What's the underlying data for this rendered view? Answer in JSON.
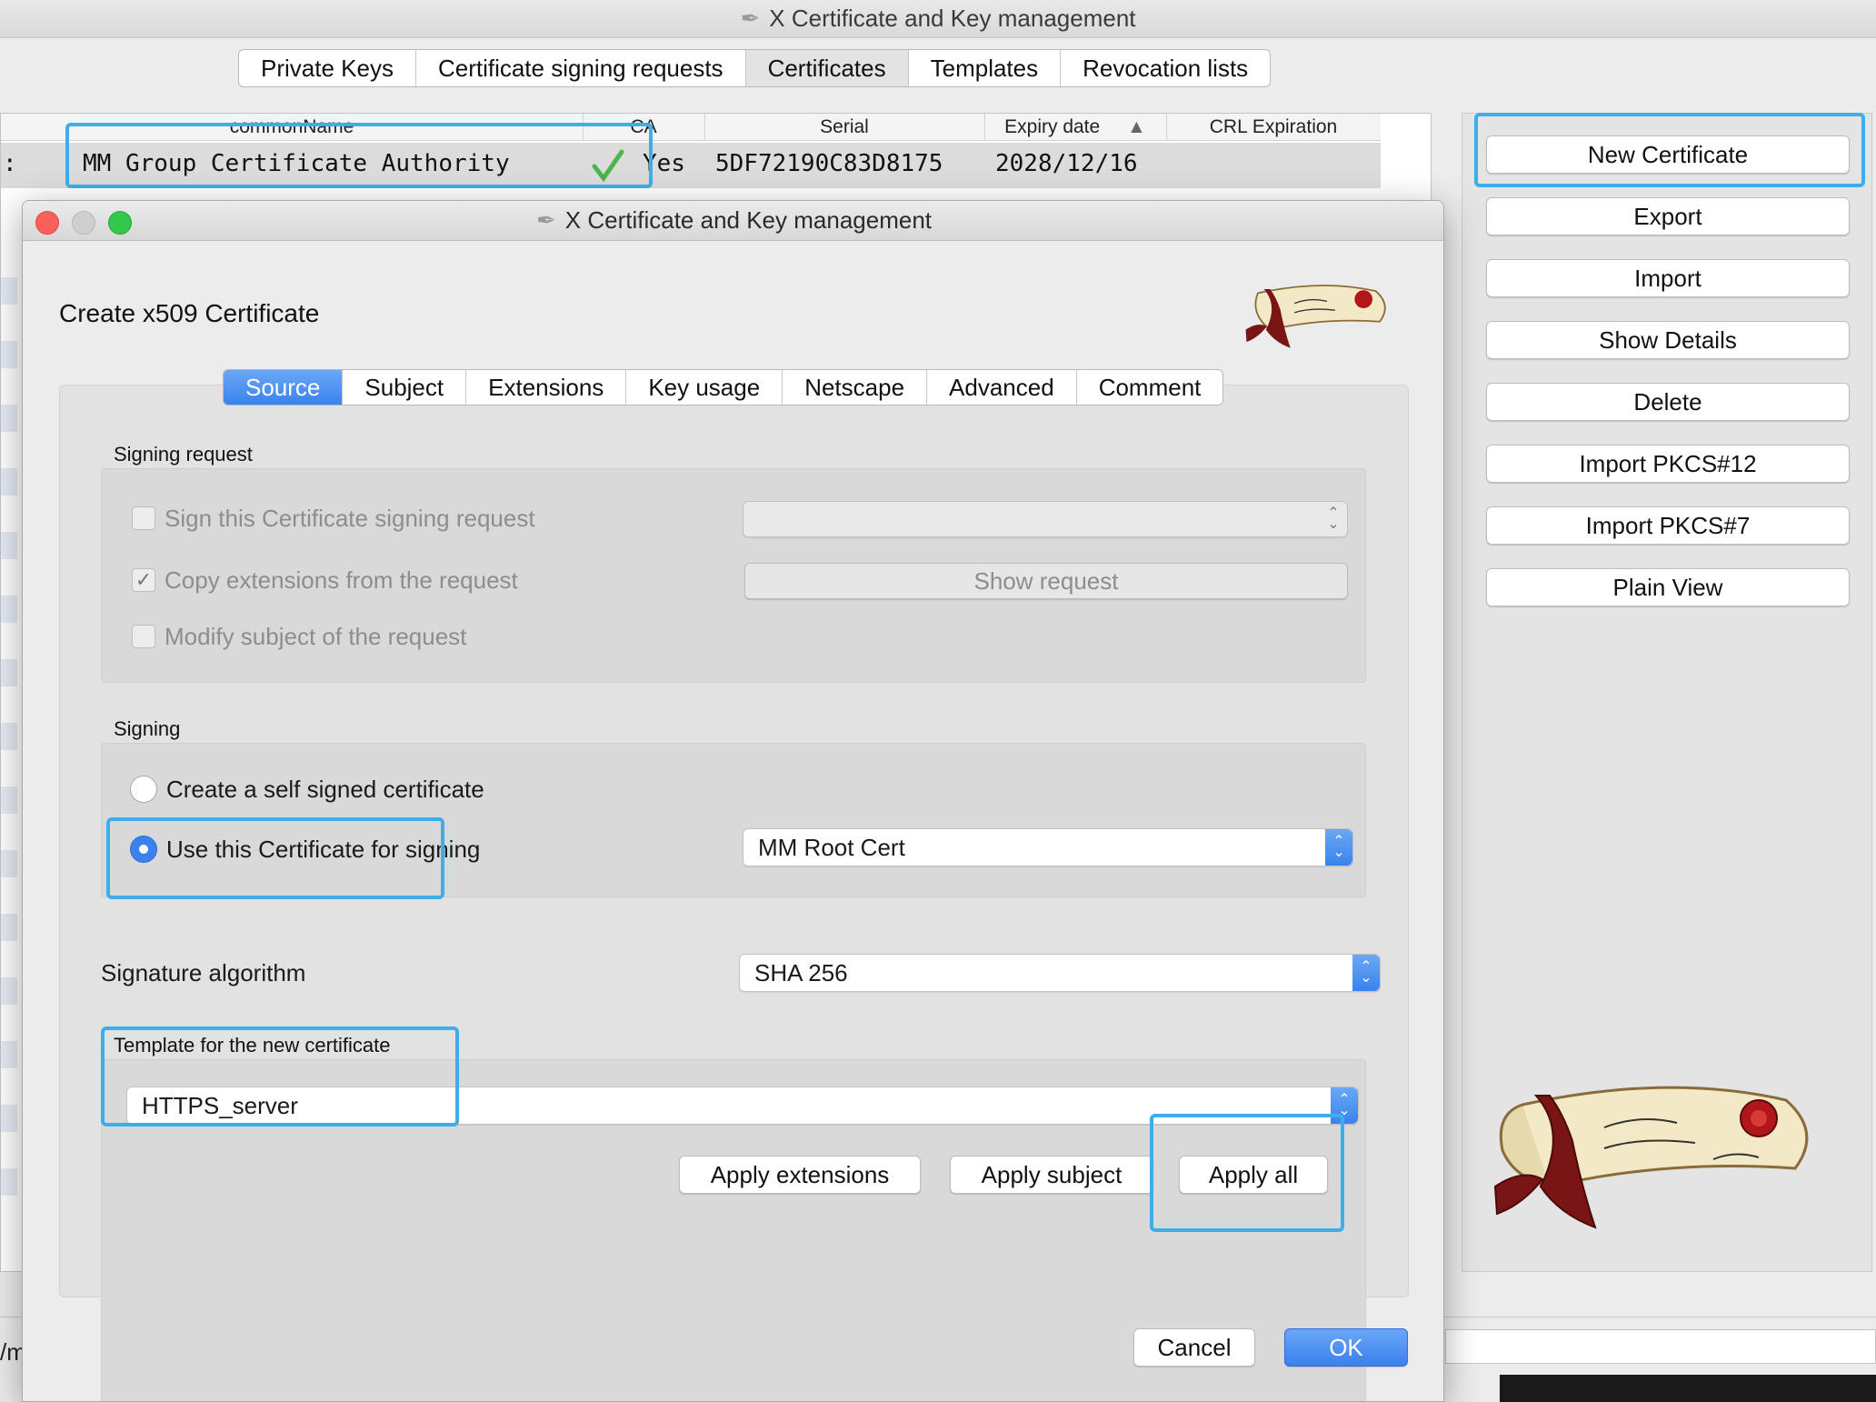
{
  "main": {
    "title": "X Certificate and Key management",
    "tabs": [
      {
        "label": "Private Keys"
      },
      {
        "label": "Certificate signing requests"
      },
      {
        "label": "Certificates"
      },
      {
        "label": "Templates"
      },
      {
        "label": "Revocation lists"
      }
    ],
    "table": {
      "columns": [
        "commonName",
        "CA",
        "Serial",
        "Expiry date",
        "CRL Expiration"
      ],
      "sort_indicator": "▲",
      "row": {
        "commonName": "MM Group Certificate Authority",
        "ca": "Yes",
        "serial": "5DF72190C83D8175",
        "expiry": "2028/12/16",
        "crl": ""
      }
    },
    "side_buttons": [
      {
        "label": "New Certificate"
      },
      {
        "label": "Export"
      },
      {
        "label": "Import"
      },
      {
        "label": "Show Details"
      },
      {
        "label": "Delete"
      },
      {
        "label": "Import PKCS#12"
      },
      {
        "label": "Import PKCS#7"
      },
      {
        "label": "Plain View"
      }
    ],
    "status_text": "/m"
  },
  "dialog": {
    "title": "X Certificate and Key management",
    "heading": "Create x509 Certificate",
    "tabs": [
      {
        "label": "Source"
      },
      {
        "label": "Subject"
      },
      {
        "label": "Extensions"
      },
      {
        "label": "Key usage"
      },
      {
        "label": "Netscape"
      },
      {
        "label": "Advanced"
      },
      {
        "label": "Comment"
      }
    ],
    "signing_request": {
      "label": "Signing request",
      "sign_csr": "Sign this Certificate signing request",
      "copy_ext": "Copy extensions from the request",
      "modify_subject": "Modify subject of the request",
      "show_request": "Show request",
      "csr_value": ""
    },
    "signing": {
      "label": "Signing",
      "self_signed": "Create a self signed certificate",
      "use_cert": "Use this Certificate for signing",
      "cert_value": "MM Root Cert"
    },
    "sig_alg": {
      "label": "Signature algorithm",
      "value": "SHA 256"
    },
    "template": {
      "label": "Template for the new certificate",
      "value": "HTTPS_server",
      "apply_extensions": "Apply extensions",
      "apply_subject": "Apply subject",
      "apply_all": "Apply all"
    },
    "cancel": "Cancel",
    "ok": "OK"
  },
  "colors": {
    "accent": "#3b82ee",
    "highlight": "#3daee9",
    "close": "#fc605c",
    "minimize": "#cfcfcf",
    "zoom": "#34c84a"
  }
}
